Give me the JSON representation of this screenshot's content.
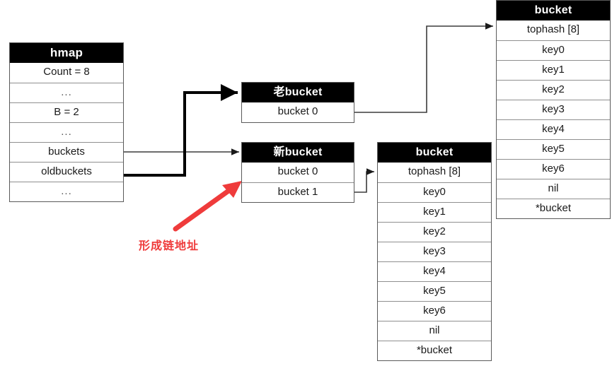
{
  "diagram": {
    "title_note": "Go hashmap bucket chaining diagram",
    "annotation": {
      "text": "形成链地址",
      "color": "#ef3b3b",
      "arrow_name": "chain-address-arrow"
    },
    "colors": {
      "header_bg": "#000000",
      "header_fg": "#ffffff",
      "border": "#5a5a5a",
      "row_border": "#8f8f8f",
      "wire": "#3b3b3b",
      "thick_wire": "#000000",
      "annotation": "#ef3b3b"
    }
  },
  "hmap": {
    "header": "hmap",
    "rows": [
      "Count = 8",
      "...",
      "B = 2",
      "...",
      "buckets",
      "oldbuckets",
      "..."
    ]
  },
  "old_bucket": {
    "header": "老bucket",
    "rows": [
      "bucket 0"
    ]
  },
  "new_bucket": {
    "header": "新bucket",
    "rows": [
      "bucket 0",
      "bucket 1"
    ]
  },
  "bucket_top": {
    "header": "bucket",
    "rows": [
      "tophash [8]",
      "key0",
      "key1",
      "key2",
      "key3",
      "key4",
      "key5",
      "key6",
      "nil",
      "*bucket"
    ]
  },
  "bucket_bottom": {
    "header": "bucket",
    "rows": [
      "tophash [8]",
      "key0",
      "key1",
      "key2",
      "key3",
      "key4",
      "key5",
      "key6",
      "nil",
      "*bucket"
    ]
  }
}
